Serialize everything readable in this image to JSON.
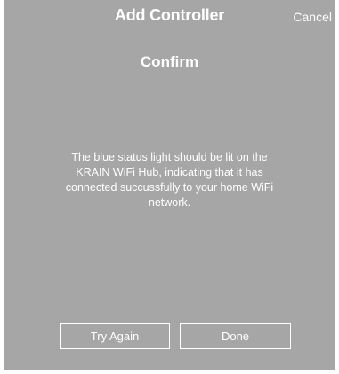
{
  "header": {
    "title": "Add Controller",
    "cancel_label": "Cancel"
  },
  "main": {
    "heading": "Confirm",
    "message": "The blue status light should be lit on the KRAIN WiFi Hub, indicating that it has connected succussfully to your home WiFi network."
  },
  "buttons": {
    "try_again_label": "Try Again",
    "done_label": "Done"
  },
  "colors": {
    "background": "#a6a6a6",
    "text": "#ffffff"
  }
}
